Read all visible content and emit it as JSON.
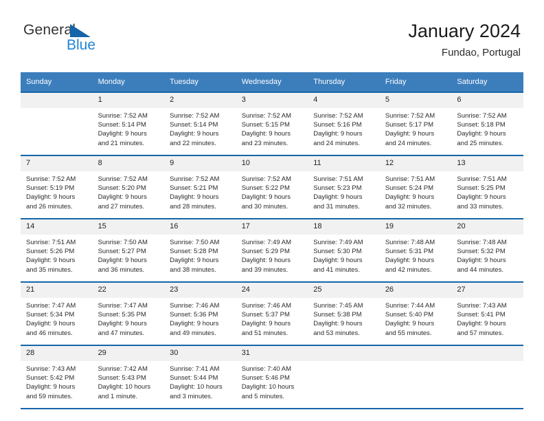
{
  "brand": {
    "name_part1": "General",
    "name_part2": "Blue",
    "triangle_icon": "triangle-icon"
  },
  "header": {
    "title": "January 2024",
    "subtitle": "Fundao, Portugal"
  },
  "calendar": {
    "weekday_headers": [
      "Sunday",
      "Monday",
      "Tuesday",
      "Wednesday",
      "Thursday",
      "Friday",
      "Saturday"
    ],
    "accent_color": "#3c7ebc",
    "separator_color": "#1565a8",
    "daynum_bg": "#f1f1f1",
    "weeks": [
      [
        {
          "day": "",
          "sunrise": "",
          "sunset": "",
          "daylight_line1": "",
          "daylight_line2": ""
        },
        {
          "day": "1",
          "sunrise": "Sunrise: 7:52 AM",
          "sunset": "Sunset: 5:14 PM",
          "daylight_line1": "Daylight: 9 hours",
          "daylight_line2": "and 21 minutes."
        },
        {
          "day": "2",
          "sunrise": "Sunrise: 7:52 AM",
          "sunset": "Sunset: 5:14 PM",
          "daylight_line1": "Daylight: 9 hours",
          "daylight_line2": "and 22 minutes."
        },
        {
          "day": "3",
          "sunrise": "Sunrise: 7:52 AM",
          "sunset": "Sunset: 5:15 PM",
          "daylight_line1": "Daylight: 9 hours",
          "daylight_line2": "and 23 minutes."
        },
        {
          "day": "4",
          "sunrise": "Sunrise: 7:52 AM",
          "sunset": "Sunset: 5:16 PM",
          "daylight_line1": "Daylight: 9 hours",
          "daylight_line2": "and 24 minutes."
        },
        {
          "day": "5",
          "sunrise": "Sunrise: 7:52 AM",
          "sunset": "Sunset: 5:17 PM",
          "daylight_line1": "Daylight: 9 hours",
          "daylight_line2": "and 24 minutes."
        },
        {
          "day": "6",
          "sunrise": "Sunrise: 7:52 AM",
          "sunset": "Sunset: 5:18 PM",
          "daylight_line1": "Daylight: 9 hours",
          "daylight_line2": "and 25 minutes."
        }
      ],
      [
        {
          "day": "7",
          "sunrise": "Sunrise: 7:52 AM",
          "sunset": "Sunset: 5:19 PM",
          "daylight_line1": "Daylight: 9 hours",
          "daylight_line2": "and 26 minutes."
        },
        {
          "day": "8",
          "sunrise": "Sunrise: 7:52 AM",
          "sunset": "Sunset: 5:20 PM",
          "daylight_line1": "Daylight: 9 hours",
          "daylight_line2": "and 27 minutes."
        },
        {
          "day": "9",
          "sunrise": "Sunrise: 7:52 AM",
          "sunset": "Sunset: 5:21 PM",
          "daylight_line1": "Daylight: 9 hours",
          "daylight_line2": "and 28 minutes."
        },
        {
          "day": "10",
          "sunrise": "Sunrise: 7:52 AM",
          "sunset": "Sunset: 5:22 PM",
          "daylight_line1": "Daylight: 9 hours",
          "daylight_line2": "and 30 minutes."
        },
        {
          "day": "11",
          "sunrise": "Sunrise: 7:51 AM",
          "sunset": "Sunset: 5:23 PM",
          "daylight_line1": "Daylight: 9 hours",
          "daylight_line2": "and 31 minutes."
        },
        {
          "day": "12",
          "sunrise": "Sunrise: 7:51 AM",
          "sunset": "Sunset: 5:24 PM",
          "daylight_line1": "Daylight: 9 hours",
          "daylight_line2": "and 32 minutes."
        },
        {
          "day": "13",
          "sunrise": "Sunrise: 7:51 AM",
          "sunset": "Sunset: 5:25 PM",
          "daylight_line1": "Daylight: 9 hours",
          "daylight_line2": "and 33 minutes."
        }
      ],
      [
        {
          "day": "14",
          "sunrise": "Sunrise: 7:51 AM",
          "sunset": "Sunset: 5:26 PM",
          "daylight_line1": "Daylight: 9 hours",
          "daylight_line2": "and 35 minutes."
        },
        {
          "day": "15",
          "sunrise": "Sunrise: 7:50 AM",
          "sunset": "Sunset: 5:27 PM",
          "daylight_line1": "Daylight: 9 hours",
          "daylight_line2": "and 36 minutes."
        },
        {
          "day": "16",
          "sunrise": "Sunrise: 7:50 AM",
          "sunset": "Sunset: 5:28 PM",
          "daylight_line1": "Daylight: 9 hours",
          "daylight_line2": "and 38 minutes."
        },
        {
          "day": "17",
          "sunrise": "Sunrise: 7:49 AM",
          "sunset": "Sunset: 5:29 PM",
          "daylight_line1": "Daylight: 9 hours",
          "daylight_line2": "and 39 minutes."
        },
        {
          "day": "18",
          "sunrise": "Sunrise: 7:49 AM",
          "sunset": "Sunset: 5:30 PM",
          "daylight_line1": "Daylight: 9 hours",
          "daylight_line2": "and 41 minutes."
        },
        {
          "day": "19",
          "sunrise": "Sunrise: 7:48 AM",
          "sunset": "Sunset: 5:31 PM",
          "daylight_line1": "Daylight: 9 hours",
          "daylight_line2": "and 42 minutes."
        },
        {
          "day": "20",
          "sunrise": "Sunrise: 7:48 AM",
          "sunset": "Sunset: 5:32 PM",
          "daylight_line1": "Daylight: 9 hours",
          "daylight_line2": "and 44 minutes."
        }
      ],
      [
        {
          "day": "21",
          "sunrise": "Sunrise: 7:47 AM",
          "sunset": "Sunset: 5:34 PM",
          "daylight_line1": "Daylight: 9 hours",
          "daylight_line2": "and 46 minutes."
        },
        {
          "day": "22",
          "sunrise": "Sunrise: 7:47 AM",
          "sunset": "Sunset: 5:35 PM",
          "daylight_line1": "Daylight: 9 hours",
          "daylight_line2": "and 47 minutes."
        },
        {
          "day": "23",
          "sunrise": "Sunrise: 7:46 AM",
          "sunset": "Sunset: 5:36 PM",
          "daylight_line1": "Daylight: 9 hours",
          "daylight_line2": "and 49 minutes."
        },
        {
          "day": "24",
          "sunrise": "Sunrise: 7:46 AM",
          "sunset": "Sunset: 5:37 PM",
          "daylight_line1": "Daylight: 9 hours",
          "daylight_line2": "and 51 minutes."
        },
        {
          "day": "25",
          "sunrise": "Sunrise: 7:45 AM",
          "sunset": "Sunset: 5:38 PM",
          "daylight_line1": "Daylight: 9 hours",
          "daylight_line2": "and 53 minutes."
        },
        {
          "day": "26",
          "sunrise": "Sunrise: 7:44 AM",
          "sunset": "Sunset: 5:40 PM",
          "daylight_line1": "Daylight: 9 hours",
          "daylight_line2": "and 55 minutes."
        },
        {
          "day": "27",
          "sunrise": "Sunrise: 7:43 AM",
          "sunset": "Sunset: 5:41 PM",
          "daylight_line1": "Daylight: 9 hours",
          "daylight_line2": "and 57 minutes."
        }
      ],
      [
        {
          "day": "28",
          "sunrise": "Sunrise: 7:43 AM",
          "sunset": "Sunset: 5:42 PM",
          "daylight_line1": "Daylight: 9 hours",
          "daylight_line2": "and 59 minutes."
        },
        {
          "day": "29",
          "sunrise": "Sunrise: 7:42 AM",
          "sunset": "Sunset: 5:43 PM",
          "daylight_line1": "Daylight: 10 hours",
          "daylight_line2": "and 1 minute."
        },
        {
          "day": "30",
          "sunrise": "Sunrise: 7:41 AM",
          "sunset": "Sunset: 5:44 PM",
          "daylight_line1": "Daylight: 10 hours",
          "daylight_line2": "and 3 minutes."
        },
        {
          "day": "31",
          "sunrise": "Sunrise: 7:40 AM",
          "sunset": "Sunset: 5:46 PM",
          "daylight_line1": "Daylight: 10 hours",
          "daylight_line2": "and 5 minutes."
        },
        {
          "day": "",
          "sunrise": "",
          "sunset": "",
          "daylight_line1": "",
          "daylight_line2": ""
        },
        {
          "day": "",
          "sunrise": "",
          "sunset": "",
          "daylight_line1": "",
          "daylight_line2": ""
        },
        {
          "day": "",
          "sunrise": "",
          "sunset": "",
          "daylight_line1": "",
          "daylight_line2": ""
        }
      ]
    ]
  }
}
